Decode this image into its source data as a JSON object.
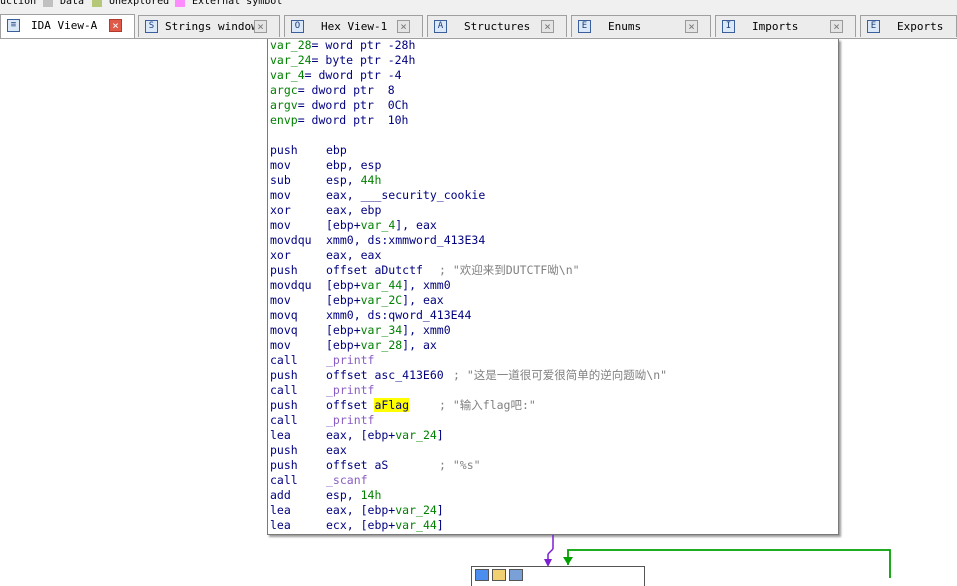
{
  "legend": [
    {
      "label": "uction",
      "color": ""
    },
    {
      "label": "Data",
      "color": "#c0c0c0"
    },
    {
      "label": "Unexplored",
      "color": "#b4c878"
    },
    {
      "label": "External symbol",
      "color": "#ff8cff"
    }
  ],
  "tabs": [
    {
      "label": "IDA View-A",
      "icon": "ida-view-icon",
      "active": true
    },
    {
      "label": "Strings window",
      "icon": "strings-icon",
      "active": false
    },
    {
      "label": "Hex View-1",
      "icon": "hex-view-icon",
      "active": false
    },
    {
      "label": "Structures",
      "icon": "structures-icon",
      "active": false
    },
    {
      "label": "Enums",
      "icon": "enums-icon",
      "active": false
    },
    {
      "label": "Imports",
      "icon": "imports-icon",
      "active": false
    },
    {
      "label": "Exports",
      "icon": "exports-icon",
      "active": false
    }
  ],
  "disasm": {
    "vars": [
      {
        "name": "var_28",
        "decl": "= word ptr -28h"
      },
      {
        "name": "var_24",
        "decl": "= byte ptr -24h"
      },
      {
        "name": "var_4",
        "decl": "= dword ptr -4"
      },
      {
        "name": "argc",
        "decl": "= dword ptr  8"
      },
      {
        "name": "argv",
        "decl": "= dword ptr  0Ch"
      },
      {
        "name": "envp",
        "decl": "= dword ptr  10h"
      }
    ],
    "instructions": [
      {
        "mnemonic": "push",
        "pre": "ebp",
        "var": "",
        "post": "",
        "comment": ""
      },
      {
        "mnemonic": "mov",
        "pre": "ebp, esp",
        "var": "",
        "post": "",
        "comment": ""
      },
      {
        "mnemonic": "sub",
        "pre": "esp, ",
        "var": "",
        "num": "44h",
        "post": "",
        "comment": ""
      },
      {
        "mnemonic": "mov",
        "pre": "eax, ___security_cookie",
        "var": "",
        "post": "",
        "comment": ""
      },
      {
        "mnemonic": "xor",
        "pre": "eax, ebp",
        "var": "",
        "post": "",
        "comment": ""
      },
      {
        "mnemonic": "mov",
        "pre": "[ebp+",
        "var": "var_4",
        "post": "], eax",
        "comment": ""
      },
      {
        "mnemonic": "movdqu",
        "pre": "xmm0, ds:xmmword_413E34",
        "var": "",
        "post": "",
        "comment": ""
      },
      {
        "mnemonic": "xor",
        "pre": "eax, eax",
        "var": "",
        "post": "",
        "comment": ""
      },
      {
        "mnemonic": "push",
        "pre": "offset aDutctf",
        "var": "",
        "post": "",
        "comment": "; \"欢迎来到DUTCTF呦\\n\""
      },
      {
        "mnemonic": "movdqu",
        "pre": "[ebp+",
        "var": "var_44",
        "post": "], xmm0",
        "comment": ""
      },
      {
        "mnemonic": "mov",
        "pre": "[ebp+",
        "var": "var_2C",
        "post": "], eax",
        "comment": ""
      },
      {
        "mnemonic": "movq",
        "pre": "xmm0, ds:qword_413E44",
        "var": "",
        "post": "",
        "comment": ""
      },
      {
        "mnemonic": "movq",
        "pre": "[ebp+",
        "var": "var_34",
        "post": "], xmm0",
        "comment": ""
      },
      {
        "mnemonic": "mov",
        "pre": "[ebp+",
        "var": "var_28",
        "post": "], ax",
        "comment": ""
      },
      {
        "mnemonic": "call",
        "pre": "",
        "func": "_printf",
        "var": "",
        "post": "",
        "comment": ""
      },
      {
        "mnemonic": "push",
        "pre": "offset asc_413E60",
        "var": "",
        "post": "",
        "comment": "; \"这是一道很可爱很简单的逆向题呦\\n\""
      },
      {
        "mnemonic": "call",
        "pre": "",
        "func": "_printf",
        "var": "",
        "post": "",
        "comment": ""
      },
      {
        "mnemonic": "push",
        "pre": "offset ",
        "hl": "aFlag",
        "var": "",
        "post": "",
        "comment": "; \"输入flag吧:\""
      },
      {
        "mnemonic": "call",
        "pre": "",
        "func": "_printf",
        "var": "",
        "post": "",
        "comment": ""
      },
      {
        "mnemonic": "lea",
        "pre": "eax, [ebp+",
        "var": "var_24",
        "post": "]",
        "comment": ""
      },
      {
        "mnemonic": "push",
        "pre": "eax",
        "var": "",
        "post": "",
        "comment": ""
      },
      {
        "mnemonic": "push",
        "pre": "offset aS",
        "var": "",
        "post": "",
        "comment": "; \"%s\""
      },
      {
        "mnemonic": "call",
        "pre": "",
        "func": "_scanf",
        "var": "",
        "post": "",
        "comment": ""
      },
      {
        "mnemonic": "add",
        "pre": "esp, ",
        "var": "",
        "num": "14h",
        "post": "",
        "comment": ""
      },
      {
        "mnemonic": "lea",
        "pre": "eax, [ebp+",
        "var": "var_24",
        "post": "]",
        "comment": ""
      },
      {
        "mnemonic": "lea",
        "pre": "ecx, [ebp+",
        "var": "var_44",
        "post": "]",
        "comment": ""
      }
    ]
  },
  "colors": {
    "mnemonic": "#000080",
    "variable": "#008000",
    "function": "#8a5cc2",
    "comment": "#808080",
    "highlight": "#ffff00",
    "edge_purple": "#7b1fd0",
    "edge_green": "#00a000"
  }
}
